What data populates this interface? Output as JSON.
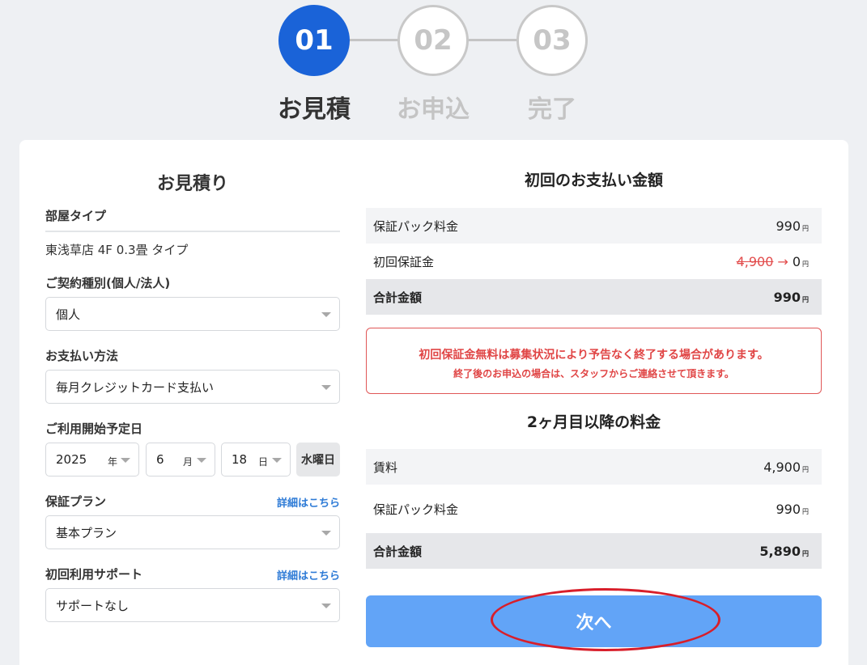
{
  "stepper": {
    "steps": [
      {
        "num": "01",
        "label": "お見積",
        "state": "active"
      },
      {
        "num": "02",
        "label": "お申込",
        "state": "inactive"
      },
      {
        "num": "03",
        "label": "完了",
        "state": "inactive"
      }
    ]
  },
  "estimate": {
    "title": "お見積り",
    "room_type_label": "部屋タイプ",
    "room_type_value": "東浅草店 4F 0.3畳 タイプ",
    "contract_type_label": "ご契約種別(個人/法人)",
    "contract_type_value": "個人",
    "payment_label": "お支払い方法",
    "payment_value": "毎月クレジットカード支払い",
    "start_date_label": "ご利用開始予定日",
    "year": "2025",
    "year_unit": "年",
    "month": "6",
    "month_unit": "月",
    "day": "18",
    "day_unit": "日",
    "weekday": "水曜日",
    "guarantee_label": "保証プラン",
    "guarantee_detail": "詳細はこちら",
    "guarantee_value": "基本プラン",
    "support_label": "初回利用サポート",
    "support_detail": "詳細はこちら",
    "support_value": "サポートなし"
  },
  "first_payment": {
    "title": "初回のお支払い金額",
    "rows": [
      {
        "label": "保証パック料金",
        "amount": "990",
        "yen": "円"
      },
      {
        "label": "初回保証金",
        "old_amount": "4,900",
        "arrow": "→",
        "amount": "0",
        "yen": "円"
      },
      {
        "label": "合計金額",
        "amount": "990",
        "yen": "円"
      }
    ],
    "notice_line1": "初回保証金無料は募集状況により予告なく終了する場合があります。",
    "notice_line2": "終了後のお申込の場合は、スタッフからご連絡させて頂きます。"
  },
  "monthly": {
    "title": "2ヶ月目以降の料金",
    "rows": [
      {
        "label": "賃料",
        "amount": "4,900",
        "yen": "円"
      },
      {
        "label": "保証パック料金",
        "amount": "990",
        "yen": "円"
      },
      {
        "label": "合計金額",
        "amount": "5,890",
        "yen": "円"
      }
    ]
  },
  "next_button": "次へ",
  "colors": {
    "primary": "#1a63d8",
    "button": "#62a4f7",
    "alert": "#e04545",
    "annotation": "#d81e2a"
  }
}
